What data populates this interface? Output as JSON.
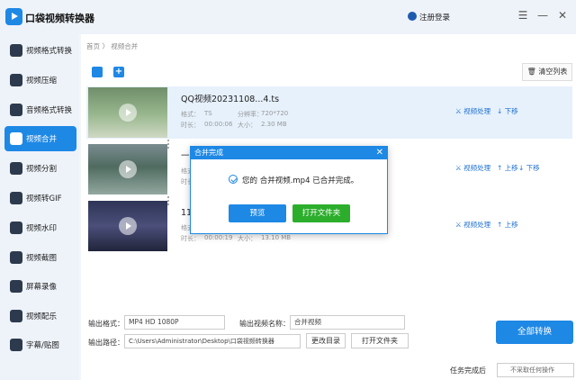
{
  "app": {
    "title": "口袋视频转换器",
    "login_label": "注册登录",
    "menu_icon": "☰",
    "minimize_icon": "—",
    "close_icon": "✕"
  },
  "sidebar": {
    "items": [
      {
        "label": "视频格式转换",
        "active": false
      },
      {
        "label": "视频压缩",
        "active": false
      },
      {
        "label": "音频格式转换",
        "active": false
      },
      {
        "label": "视频合并",
        "active": true
      },
      {
        "label": "视频分割",
        "active": false
      },
      {
        "label": "视频转GIF",
        "active": false
      },
      {
        "label": "视频水印",
        "active": false
      },
      {
        "label": "视频截图",
        "active": false
      },
      {
        "label": "屏幕录像",
        "active": false
      },
      {
        "label": "视频配乐",
        "active": false
      },
      {
        "label": "字幕/贴图",
        "active": false
      }
    ]
  },
  "breadcrumb": "首页 〉 视频合并",
  "toolbar": {
    "clear_label": "🗑 清空列表"
  },
  "files": [
    {
      "name": "QQ视频20231108...4.ts",
      "format_label": "格式：",
      "format": "TS",
      "res_label": "分辨率：",
      "resolution": "720*720",
      "dur_label": "时长：",
      "duration": "00:00:06",
      "size_label": "大小：",
      "size": "2.30 MB",
      "process": "⚔ 视频处理",
      "up": "",
      "down": "↓ 下移"
    },
    {
      "name": "一段",
      "format_label": "格式",
      "format": "",
      "res_label": "",
      "resolution": "",
      "dur_label": "时长",
      "duration": "",
      "size_label": "",
      "size": "",
      "process": "⚔ 视频处理",
      "up": "↑ 上移",
      "down": "↓ 下移"
    },
    {
      "name": "11月",
      "format_label": "格式",
      "format": "",
      "res_label": "",
      "resolution": "",
      "dur_label": "时长：",
      "duration": "00:00:19",
      "size_label": "大小：",
      "size": "13.10 MB",
      "process": "⚔ 视频处理",
      "up": "↑ 上移",
      "down": ""
    }
  ],
  "dialog": {
    "title": "合并完成",
    "message": "您的 合并视频.mp4 已合并完成。",
    "preview_label": "预览",
    "open_folder_label": "打开文件夹",
    "close_icon": "✕"
  },
  "settings": {
    "format_label": "输出格式：",
    "format_value": "MP4   HD 1080P",
    "name_label": "输出视频名称：",
    "name_value": "合并视频",
    "path_label": "输出路径：",
    "path_value": "C:\\Users\\Administrator\\Desktop\\口袋视频转换器",
    "change_dir_label": "更改目录",
    "open_folder_label": "打开文件夹",
    "convert_all_label": "全部转换",
    "after_label": "任务完成后",
    "after_value": "不采取任何操作"
  },
  "colors": {
    "accent": "#1e88e5",
    "green": "#2cae2c"
  }
}
